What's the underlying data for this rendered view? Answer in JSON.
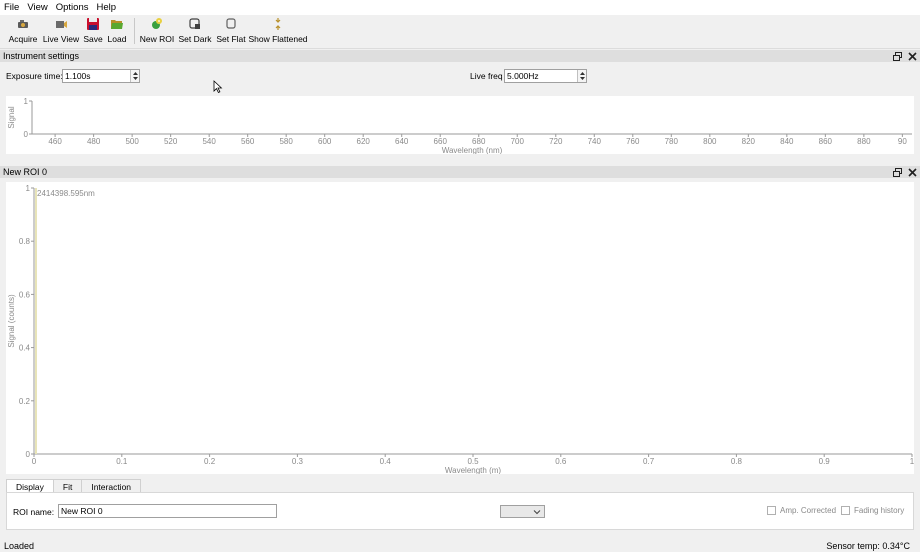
{
  "menu": [
    "File",
    "View",
    "Options",
    "Help"
  ],
  "toolbar": {
    "acquire": "Acquire",
    "live_view": "Live View",
    "save": "Save",
    "load": "Load",
    "new_roi": "New ROI",
    "set_dark": "Set Dark",
    "set_flat": "Set Flat",
    "show_flattened": "Show Flattened"
  },
  "instrument": {
    "title": "Instrument settings",
    "exposure_label": "Exposure time:",
    "exposure_value": "1.100s",
    "live_freq_label": "Live freq",
    "live_freq_value": "5.000Hz"
  },
  "roi": {
    "title": "New ROI 0",
    "name_label": "ROI name:",
    "name_value": "New ROI 0",
    "amp_corrected": "Amp. Corrected",
    "fading_history": "Fading history",
    "tabs": [
      "Display",
      "Fit",
      "Interaction"
    ]
  },
  "status": {
    "left": "Loaded",
    "right": "Sensor temp: 0.34°C"
  },
  "chart_data": [
    {
      "type": "line",
      "xlabel": "Wavelength (nm)",
      "ylabel": "Signal",
      "xlim": [
        448,
        905
      ],
      "ylim": [
        0,
        1
      ],
      "x_ticks": [
        "460",
        "480",
        "500",
        "520",
        "540",
        "560",
        "580",
        "600",
        "620",
        "640",
        "660",
        "680",
        "700",
        "720",
        "740",
        "760",
        "780",
        "800",
        "820",
        "840",
        "860",
        "880",
        "90"
      ],
      "y_ticks": [
        "0",
        "1"
      ],
      "series": []
    },
    {
      "type": "line",
      "xlabel": "Wavelength (m)",
      "ylabel": "Signal (counts)",
      "xlim": [
        0,
        1
      ],
      "ylim": [
        0,
        1
      ],
      "x_ticks": [
        "0",
        "0.1",
        "0.2",
        "0.3",
        "0.4",
        "0.5",
        "0.6",
        "0.7",
        "0.8",
        "0.9",
        "1"
      ],
      "y_ticks": [
        "0",
        "0.2",
        "0.4",
        "0.6",
        "0.8",
        "1"
      ],
      "annotation": "2414398.595nm",
      "series": []
    }
  ]
}
